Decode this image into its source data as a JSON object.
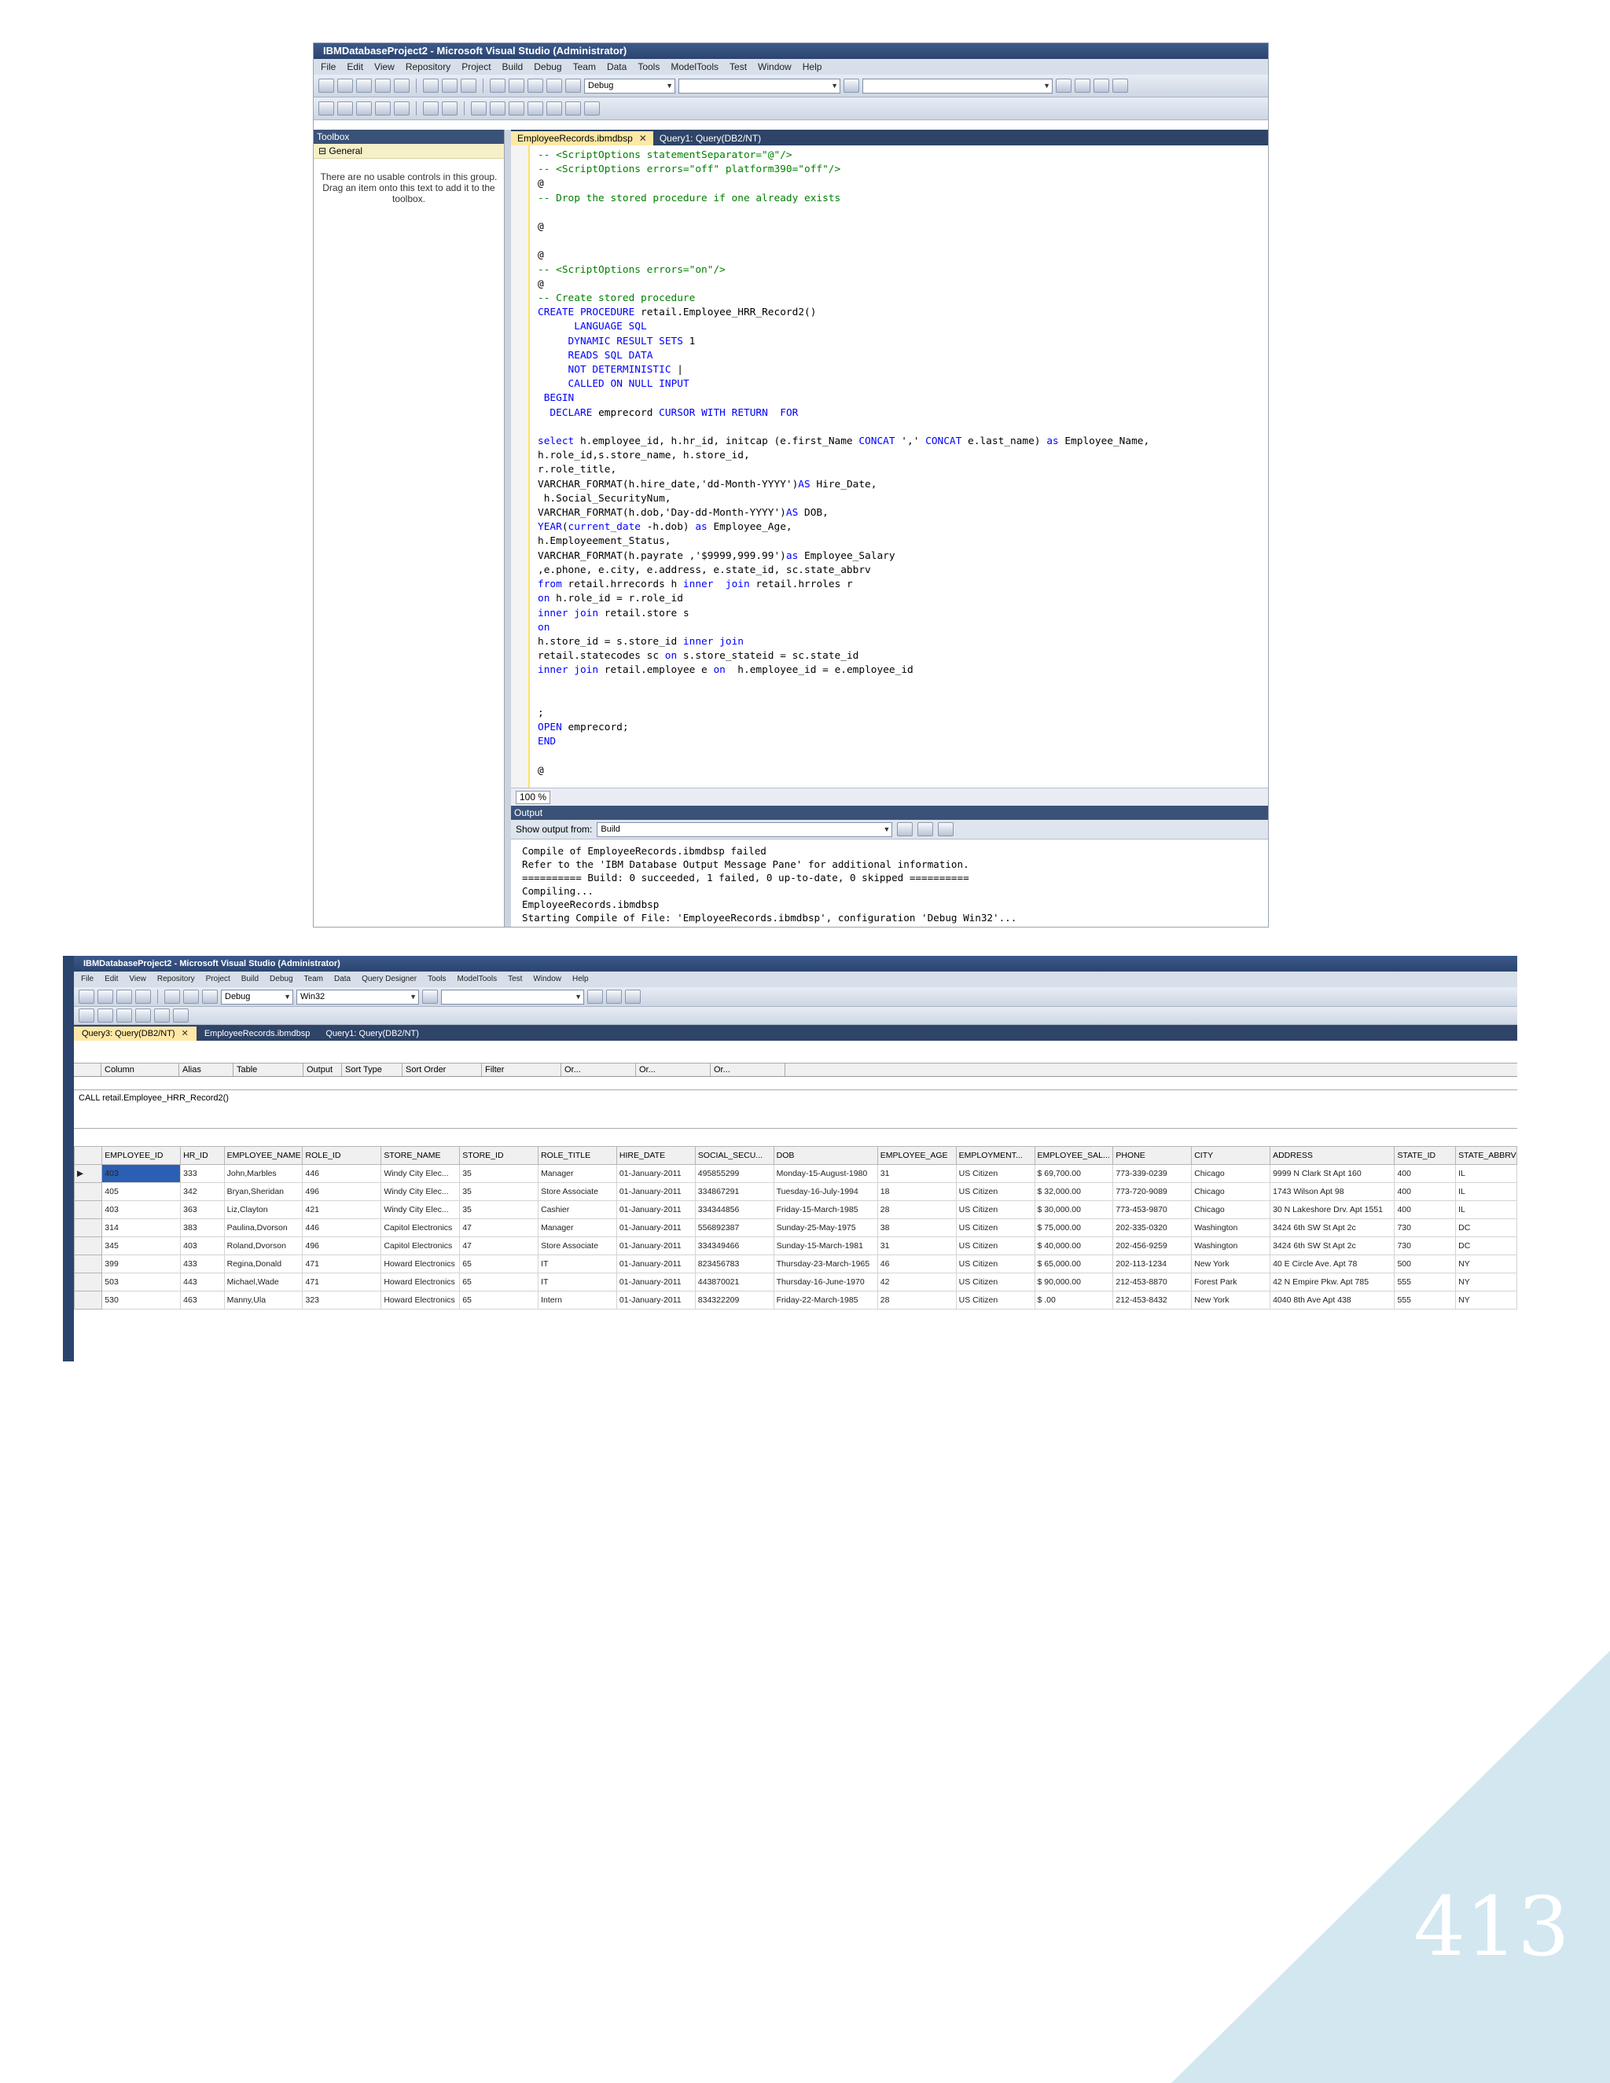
{
  "vs_editor": {
    "title": "IBMDatabaseProject2 - Microsoft Visual Studio (Administrator)",
    "menu": [
      "File",
      "Edit",
      "View",
      "Repository",
      "Project",
      "Build",
      "Debug",
      "Team",
      "Data",
      "Tools",
      "ModelTools",
      "Test",
      "Window",
      "Help"
    ],
    "config_combo": "Debug",
    "toolbox": {
      "header": "Toolbox",
      "group": "General",
      "message": "There are no usable controls in this group. Drag an item onto this text to add it to the toolbox."
    },
    "tabs": [
      "EmployeeRecords.ibmdbsp",
      "Query1: Query(DB2/NT)"
    ],
    "code_lines": [
      "-- <ScriptOptions statementSeparator=\"@\"/>",
      "-- <ScriptOptions errors=\"off\" platform390=\"off\"/>",
      "@",
      "-- Drop the stored procedure if one already exists",
      "",
      "@",
      "",
      "@",
      "-- <ScriptOptions errors=\"on\"/>",
      "@",
      "-- Create stored procedure",
      "CREATE PROCEDURE retail.Employee_HRR_Record2()",
      "      LANGUAGE SQL",
      "     DYNAMIC RESULT SETS 1",
      "     READS SQL DATA",
      "     NOT DETERMINISTIC |",
      "     CALLED ON NULL INPUT",
      " BEGIN",
      "  DECLARE emprecord CURSOR WITH RETURN  FOR",
      "",
      "select h.employee_id, h.hr_id, initcap (e.first_Name CONCAT ',' CONCAT e.last_name) as Employee_Name,",
      "h.role_id,s.store_name, h.store_id,",
      "r.role_title,",
      "VARCHAR_FORMAT(h.hire_date,'dd-Month-YYYY')AS Hire_Date,",
      " h.Social_SecurityNum,",
      "VARCHAR_FORMAT(h.dob,'Day-dd-Month-YYYY')AS DOB,",
      "YEAR(current_date -h.dob) as Employee_Age,",
      "h.Employeement_Status,",
      "VARCHAR_FORMAT(h.payrate ,'$9999,999.99')as Employee_Salary",
      ",e.phone, e.city, e.address, e.state_id, sc.state_abbrv",
      "from retail.hrrecords h inner  join retail.hrroles r",
      "on h.role_id = r.role_id",
      "inner join retail.store s",
      "on",
      "h.store_id = s.store_id inner join",
      "retail.statecodes sc on s.store_stateid = sc.state_id",
      "inner join retail.employee e on  h.employee_id = e.employee_id",
      "",
      "",
      ";",
      "OPEN emprecord;",
      "END",
      "",
      "@"
    ],
    "zoom": "100 %",
    "output": {
      "header": "Output",
      "show_label": "Show output from:",
      "show_value": "Build",
      "lines": [
        "Compile of EmployeeRecords.ibmdbsp failed",
        "Refer to the 'IBM Database Output Message Pane' for additional information.",
        "========== Build: 0 succeeded, 1 failed, 0 up-to-date, 0 skipped ==========",
        "Compiling...",
        "EmployeeRecords.ibmdbsp",
        "Starting Compile of File: 'EmployeeRecords.ibmdbsp', configuration 'Debug Win32'..."
      ]
    }
  },
  "query_results": {
    "title": "IBMDatabaseProject2 - Microsoft Visual Studio (Administrator)",
    "menu": [
      "File",
      "Edit",
      "View",
      "Repository",
      "Project",
      "Build",
      "Debug",
      "Team",
      "Data",
      "Query Designer",
      "Tools",
      "ModelTools",
      "Test",
      "Window",
      "Help"
    ],
    "config_combo": "Debug",
    "platform_combo": "Win32",
    "tabs": [
      "Query3: Query(DB2/NT)",
      "EmployeeRecords.ibmdbsp",
      "Query1: Query(DB2/NT)"
    ],
    "criteria_headers": [
      "Column",
      "Alias",
      "Table",
      "Output",
      "Sort Type",
      "Sort Order",
      "Filter",
      "Or...",
      "Or...",
      "Or..."
    ],
    "sql": "CALL retail.Employee_HRR_Record2()",
    "columns": [
      "EMPLOYEE_ID",
      "HR_ID",
      "EMPLOYEE_NAME",
      "ROLE_ID",
      "STORE_NAME",
      "STORE_ID",
      "ROLE_TITLE",
      "HIRE_DATE",
      "SOCIAL_SECU...",
      "DOB",
      "EMPLOYEE_AGE",
      "EMPLOYMENT...",
      "EMPLOYEE_SAL...",
      "PHONE",
      "CITY",
      "ADDRESS",
      "STATE_ID",
      "STATE_ABBRV"
    ],
    "rows": [
      [
        "403",
        "333",
        "John,Marbles",
        "446",
        "Windy City Elec...",
        "35",
        "Manager",
        "01-January-2011",
        "495855299",
        "Monday-15-August-1980",
        "31",
        "US Citizen",
        "$ 69,700.00",
        "773-339-0239",
        "Chicago",
        "9999 N Clark St Apt 160",
        "400",
        "IL"
      ],
      [
        "405",
        "342",
        "Bryan,Sheridan",
        "496",
        "Windy City Elec...",
        "35",
        "Store Associate",
        "01-January-2011",
        "334867291",
        "Tuesday-16-July-1994",
        "18",
        "US Citizen",
        "$ 32,000.00",
        "773-720-9089",
        "Chicago",
        "1743 Wilson Apt 98",
        "400",
        "IL"
      ],
      [
        "403",
        "363",
        "Liz,Clayton",
        "421",
        "Windy City Elec...",
        "35",
        "Cashier",
        "01-January-2011",
        "334344856",
        "Friday-15-March-1985",
        "28",
        "US Citizen",
        "$ 30,000.00",
        "773-453-9870",
        "Chicago",
        "30 N Lakeshore Drv. Apt 1551",
        "400",
        "IL"
      ],
      [
        "314",
        "383",
        "Paulina,Dvorson",
        "446",
        "Capitol Electronics",
        "47",
        "Manager",
        "01-January-2011",
        "556892387",
        "Sunday-25-May-1975",
        "38",
        "US Citizen",
        "$ 75,000.00",
        "202-335-0320",
        "Washington",
        "3424 6th SW St Apt 2c",
        "730",
        "DC"
      ],
      [
        "345",
        "403",
        "Roland,Dvorson",
        "496",
        "Capitol Electronics",
        "47",
        "Store Associate",
        "01-January-2011",
        "334349466",
        "Sunday-15-March-1981",
        "31",
        "US Citizen",
        "$ 40,000.00",
        "202-456-9259",
        "Washington",
        "3424 6th SW St Apt 2c",
        "730",
        "DC"
      ],
      [
        "399",
        "433",
        "Regina,Donald",
        "471",
        "Howard Electronics",
        "65",
        "IT",
        "01-January-2011",
        "823456783",
        "Thursday-23-March-1965",
        "46",
        "US Citizen",
        "$ 65,000.00",
        "202-113-1234",
        "New York",
        "40 E Circle Ave. Apt 78",
        "500",
        "NY"
      ],
      [
        "503",
        "443",
        "Michael,Wade",
        "471",
        "Howard Electronics",
        "65",
        "IT",
        "01-January-2011",
        "443870021",
        "Thursday-16-June-1970",
        "42",
        "US Citizen",
        "$ 90,000.00",
        "212-453-8870",
        "Forest Park",
        "42 N Empire Pkw. Apt 785",
        "555",
        "NY"
      ],
      [
        "530",
        "463",
        "Manny,Ula",
        "323",
        "Howard Electronics",
        "65",
        "Intern",
        "01-January-2011",
        "834322209",
        "Friday-22-March-1985",
        "28",
        "US Citizen",
        "$ .00",
        "212-453-8432",
        "New York",
        "4040 8th Ave Apt 438",
        "555",
        "NY"
      ]
    ]
  },
  "page": {
    "number": "413",
    "accent_color": "#d2e7f0"
  }
}
